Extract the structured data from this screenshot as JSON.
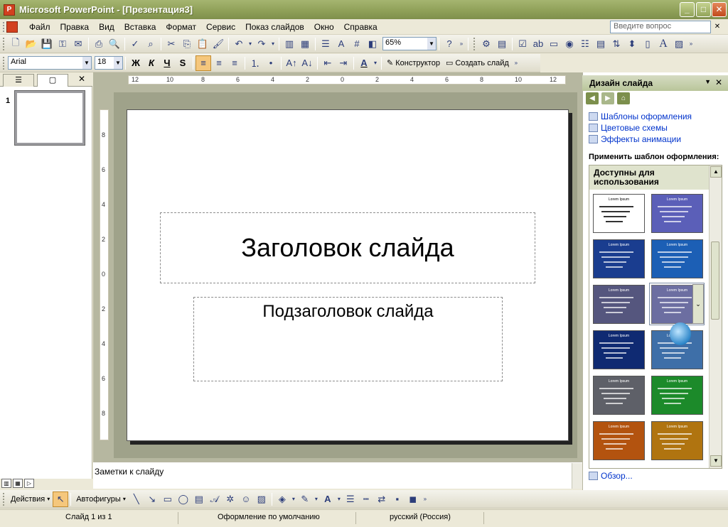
{
  "window": {
    "title": "Microsoft PowerPoint - [Презентация3]",
    "app_icon": "P"
  },
  "menu": {
    "items": [
      "Файл",
      "Правка",
      "Вид",
      "Вставка",
      "Формат",
      "Сервис",
      "Показ слайдов",
      "Окно",
      "Справка"
    ],
    "help_placeholder": "Введите вопрос"
  },
  "standard_toolbar": {
    "zoom": "65%"
  },
  "formatting_toolbar": {
    "font": "Arial",
    "size": "18",
    "bold": "Ж",
    "italic": "К",
    "underline": "Ч",
    "shadow": "S",
    "designer": "Конструктор",
    "new_slide": "Создать слайд"
  },
  "left_pane": {
    "slide_number": "1"
  },
  "slide": {
    "title": "Заголовок слайда",
    "subtitle": "Подзаголовок слайда"
  },
  "notes": {
    "placeholder": "Заметки к слайду"
  },
  "task_pane": {
    "title": "Дизайн слайда",
    "links": [
      "Шаблоны оформления",
      "Цветовые схемы",
      "Эффекты анимации"
    ],
    "apply_label": "Применить шаблон оформления:",
    "section": "Доступны для использования",
    "template_title": "Lorem Ipsum",
    "browse": "Обзор..."
  },
  "drawing_toolbar": {
    "actions": "Действия",
    "autoshapes": "Автофигуры"
  },
  "status": {
    "slide": "Слайд 1 из 1",
    "design": "Оформление по умолчанию",
    "language": "русский (Россия)"
  },
  "colors": {
    "titlebar": "#8e9f57",
    "taskpane_header": "#b9c59a",
    "link": "#0033cc"
  },
  "ruler": {
    "h_ticks": [
      "12",
      "10",
      "8",
      "6",
      "4",
      "2",
      "0",
      "2",
      "4",
      "6",
      "8",
      "10",
      "12"
    ],
    "v_ticks": [
      "8",
      "6",
      "4",
      "2",
      "0",
      "2",
      "4",
      "6",
      "8"
    ]
  },
  "templates": [
    {
      "bg": "#ffffff",
      "fg": "#000"
    },
    {
      "bg": "#5b5fb8",
      "fg": "#fff"
    },
    {
      "bg": "#1a3d8f",
      "fg": "#fff"
    },
    {
      "bg": "#1c5fb5",
      "fg": "#fff"
    },
    {
      "bg": "#55567e",
      "fg": "#fff"
    },
    {
      "bg": "#4c4e8a",
      "fg": "#fff"
    },
    {
      "bg": "#0f2a72",
      "fg": "#fff"
    },
    {
      "bg": "#3e6fa8",
      "fg": "#fff"
    },
    {
      "bg": "#5e6068",
      "fg": "#fff"
    },
    {
      "bg": "#1c8a2a",
      "fg": "#fff"
    },
    {
      "bg": "#b3530f",
      "fg": "#fff"
    },
    {
      "bg": "#b07410",
      "fg": "#fff"
    }
  ]
}
